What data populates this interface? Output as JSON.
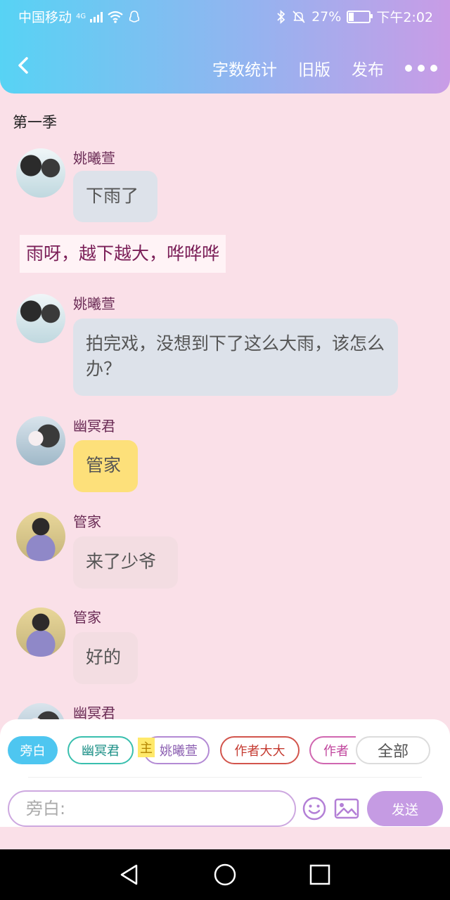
{
  "status_bar": {
    "carrier": "中国移动",
    "net_tag": "4G",
    "battery": "27%",
    "time": "下午2:02"
  },
  "nav": {
    "actions": [
      "字数统计",
      "旧版",
      "发布"
    ]
  },
  "chat": {
    "section_title": "第一季",
    "messages": [
      {
        "kind": "dialog",
        "name": "姚曦萱",
        "text": "下雨了"
      },
      {
        "kind": "narration",
        "text": "雨呀，越下越大，哗哗哗"
      },
      {
        "kind": "dialog",
        "name": "姚曦萱",
        "text": "拍完戏，没想到下了这么大雨，该怎么办？"
      },
      {
        "kind": "dialog",
        "name": "幽冥君",
        "text": "管家"
      },
      {
        "kind": "dialog",
        "name": "管家",
        "text": "来了少爷"
      },
      {
        "kind": "dialog",
        "name": "管家",
        "text": "好的"
      },
      {
        "kind": "dialog",
        "name": "幽冥君",
        "text": ""
      }
    ]
  },
  "role_bar": {
    "chips": [
      "旁白",
      "幽冥君",
      "姚曦萱",
      "作者大大",
      "作者",
      "全部"
    ],
    "lead_mark": "主",
    "input_placeholder": "旁白:",
    "send_label": "发送"
  },
  "colors": {
    "header_start": "#57d3f4",
    "header_end": "#c99ce6",
    "chat_bg": "#fae0e8",
    "accent_blue": "#4ec6f0",
    "accent_purple": "#c59be3"
  }
}
